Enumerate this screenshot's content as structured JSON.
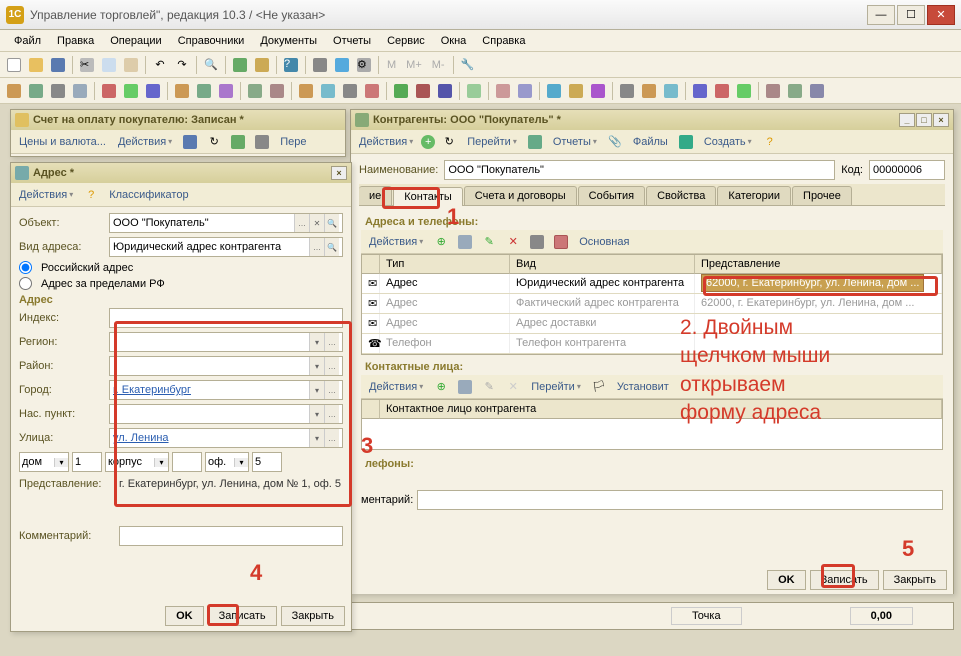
{
  "window": {
    "title": "Управление торговлей\", редакция 10.3 / <Не указан>",
    "logo_text": "1C"
  },
  "menu": [
    "Файл",
    "Правка",
    "Операции",
    "Справочники",
    "Документы",
    "Отчеты",
    "Сервис",
    "Окна",
    "Справка"
  ],
  "mdi_invoice": {
    "title": "Счет на оплату покупателю: Записан *",
    "toolbar": {
      "prices": "Цены и валюта...",
      "actions": "Действия",
      "go": "Пере"
    }
  },
  "mdi_address": {
    "title": "Адрес *",
    "actions": "Действия",
    "classifier": "Классификатор",
    "labels": {
      "object": "Объект:",
      "kind": "Вид адреса:",
      "ru": "Российский адрес",
      "abroad": "Адрес за пределами РФ",
      "addr": "Адрес",
      "index": "Индекс:",
      "region": "Регион:",
      "district": "Район:",
      "city": "Город:",
      "settlement": "Нас. пункт:",
      "street": "Улица:",
      "house": "дом",
      "presentation": "Представление:",
      "comment": "Комментарий:"
    },
    "values": {
      "object": "ООО \"Покупатель\"",
      "kind": "Юридический адрес контрагента",
      "city": "г. Екатеринбург",
      "street": "ул. Ленина",
      "house_no": "1",
      "korpus": "корпус",
      "korpus_no": "",
      "of": "оф.",
      "of_no": "5",
      "presentation": "г. Екатеринбург, ул. Ленина, дом № 1, оф. 5"
    },
    "buttons": {
      "ok": "OK",
      "save": "Записать",
      "close": "Закрыть"
    }
  },
  "mdi_counterparty": {
    "title": "Контрагенты: ООО \"Покупатель\" *",
    "toolbar": {
      "actions": "Действия",
      "go": "Перейти",
      "reports": "Отчеты",
      "files": "Файлы",
      "create": "Создать"
    },
    "name_label": "Наименование:",
    "name_value": "ООО \"Покупатель\"",
    "code_label": "Код:",
    "code_value": "00000006",
    "tabs": [
      "Общие",
      "Контакты",
      "Счета и договоры",
      "События",
      "Свойства",
      "Категории",
      "Прочее"
    ],
    "sec1": "Адреса и телефоны:",
    "inner_toolbar": {
      "actions": "Действия",
      "main": "Основная"
    },
    "grid": {
      "headers": {
        "type": "Тип",
        "kind": "Вид",
        "rep": "Представление"
      },
      "rows": [
        {
          "type": "Адрес",
          "kind": "Юридический адрес контрагента",
          "rep": "62000, г. Екатеринбург, ул. Ленина, дом ...",
          "selected": true
        },
        {
          "type": "Адрес",
          "kind": "Фактический адрес контрагента",
          "rep": "62000, г. Екатеринбург, ул. Ленина, дом ..."
        },
        {
          "type": "Адрес",
          "kind": "Адрес доставки",
          "rep": ""
        },
        {
          "type": "Телефон",
          "kind": "Телефон контрагента",
          "rep": ""
        }
      ]
    },
    "sec2": "Контактные лица:",
    "inner_toolbar2": {
      "actions": "Действия",
      "go": "Перейти",
      "set": "Установит"
    },
    "grid2": {
      "header": "Контактное лицо контрагента"
    },
    "sec3": "лефоны:",
    "sec4": "ментарий:",
    "buttons": {
      "ok": "OK",
      "save": "Записать",
      "close": "Закрыть"
    },
    "bottom": {
      "tochka": "Точка",
      "zero": "0,00"
    }
  },
  "annotations": {
    "num1": "1",
    "num2_text": "2. Двойным\nщелчком мыши\nоткрываем\nформу адреса",
    "num3": "3",
    "num4": "4",
    "num5": "5"
  }
}
